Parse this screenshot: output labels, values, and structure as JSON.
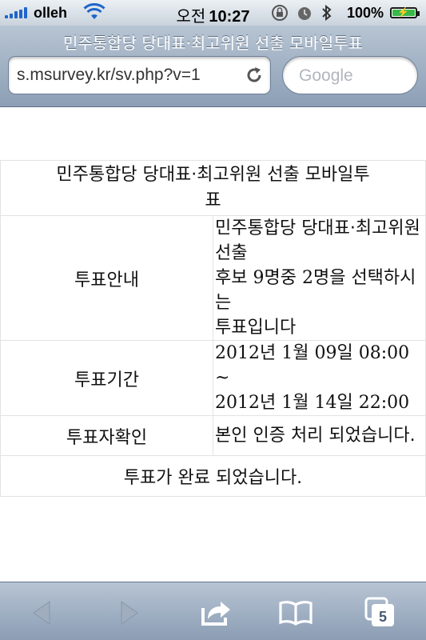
{
  "status_bar": {
    "carrier": "olleh",
    "time_ampm": "오전",
    "time": "10:27",
    "battery_percent": "100%",
    "battery_level": 1.0,
    "icons": [
      "signal-icon",
      "wifi-icon",
      "orientation-lock-icon",
      "alarm-icon",
      "bluetooth-icon",
      "battery-icon"
    ]
  },
  "browser": {
    "page_title": "민주통합당 당대표·최고위원 선출 모바일투표",
    "url": "s.msurvey.kr/sv.php?v=1",
    "search_placeholder": "Google"
  },
  "vote_info": {
    "title_line1": "민주통합당 당대표·최고위원 선출 모바일투",
    "title_line2": "표",
    "guide_label": "투표안내",
    "guide_line1": "민주통합당 당대표·최고위원",
    "guide_line2": "선출",
    "guide_line3_pre": "후보 ",
    "guide_line3_num1": "9",
    "guide_line3_mid": "명중 ",
    "guide_line3_num2": "2",
    "guide_line3_post": "명을 선택하시는",
    "guide_line4": "투표입니다",
    "period_label": "투표기간",
    "period_start_year": "2012",
    "period_start_year_unit": "년 ",
    "period_start_month": "1",
    "period_start_month_unit": "월 ",
    "period_start_day": "09",
    "period_start_day_unit": "일 ",
    "period_start_time": "08:00 ~",
    "period_end_year": "2012",
    "period_end_year_unit": "년 ",
    "period_end_month": "1",
    "period_end_month_unit": "월 ",
    "period_end_day": "14",
    "period_end_day_unit": "일 ",
    "period_end_time": "22:00",
    "verify_label": "투표자확인",
    "verify_value": "본인 인증 처리 되었습니다.",
    "completion": "투표가 완료 되었습니다."
  },
  "toolbar": {
    "buttons": [
      "back-icon",
      "forward-icon",
      "share-icon",
      "bookmarks-icon",
      "tabs-icon"
    ],
    "tab_count": "5"
  },
  "colors": {
    "chrome_blue": "#9aaabd",
    "signal_blue": "#1f66c9",
    "verified_red": "#e0121b",
    "battery_green": "#39b84a"
  }
}
